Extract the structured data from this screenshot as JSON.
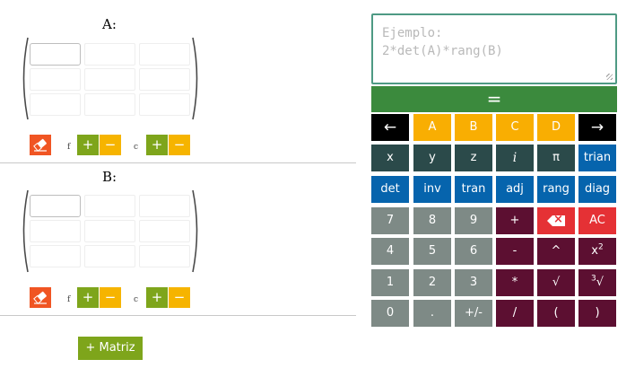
{
  "matrices": [
    {
      "title": "A:",
      "row_label": "f",
      "col_label": "c",
      "plus": "+",
      "minus": "−"
    },
    {
      "title": "B:",
      "row_label": "f",
      "col_label": "c",
      "plus": "+",
      "minus": "−"
    }
  ],
  "add_matrix_label": "+ Matriz",
  "expression": {
    "placeholder": "Ejemplo:\n2*det(A)*rang(B)",
    "value": ""
  },
  "equals_label": "=",
  "keypad": {
    "row1": [
      "←",
      "A",
      "B",
      "C",
      "D",
      "→"
    ],
    "row2": [
      "x",
      "y",
      "z",
      "i",
      "π",
      "trian"
    ],
    "row3": [
      "det",
      "inv",
      "tran",
      "adj",
      "rang",
      "diag"
    ],
    "row4": [
      "7",
      "8",
      "9",
      "+",
      "",
      "AC"
    ],
    "row5": [
      "4",
      "5",
      "6",
      "-",
      "^",
      "x2"
    ],
    "row6": [
      "1",
      "2",
      "3",
      "*",
      "√",
      "3√"
    ],
    "row7": [
      "0",
      ".",
      "+/-",
      "/",
      "(",
      ")"
    ]
  },
  "colors": {
    "eraser": "#f05523",
    "plus": "#7ea51b",
    "minus": "#f6b400",
    "equals": "#3b8a3d",
    "nav": "#000000",
    "matrix_keys": "#f9ae02",
    "vars": "#2b4a4a",
    "functions": "#0664ad",
    "digits": "#7e8a86",
    "operators": "#5c0f31",
    "clear": "#e53135",
    "input_border": "#4e9a84"
  },
  "icons": {
    "eraser": "eraser-icon",
    "backspace": "backspace-icon"
  }
}
